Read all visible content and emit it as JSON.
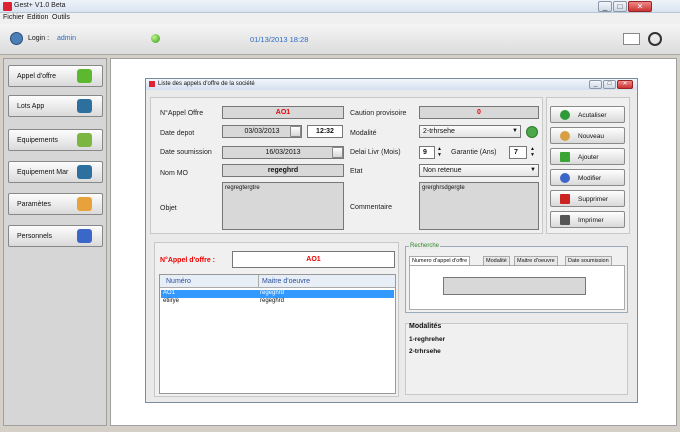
{
  "window": {
    "title": "Gest+ V1.0 Beta"
  },
  "menu": [
    "Fichier",
    "Edition",
    "Outils"
  ],
  "toolbar": {
    "login_label": "Login :",
    "user": "admin",
    "datetime": "01/13/2013  18:28"
  },
  "sidebar": {
    "items": [
      {
        "label": "Appel d'offre",
        "icon": "offer-icon",
        "color": "#5cb82e"
      },
      {
        "label": "Lots App",
        "icon": "camera-icon",
        "color": "#2d6f9e"
      },
      {
        "label": "Equipements",
        "icon": "box-icon",
        "color": "#7bb640"
      },
      {
        "label": "Equipement Mar",
        "icon": "camera-icon",
        "color": "#2d6f9e"
      },
      {
        "label": "Paramètes",
        "icon": "settings-icon",
        "color": "#e7a23b"
      },
      {
        "label": "Personnels",
        "icon": "people-icon",
        "color": "#3b67c9"
      }
    ]
  },
  "inner": {
    "title": "Liste des appels d'offre de la société",
    "form": {
      "napp_label": "N°Appel Offre",
      "napp_value": "AO1",
      "date_depot_label": "Date depot",
      "date_depot_value": "03/03/2013",
      "time_value": "12:32",
      "date_soum_label": "Date soumission",
      "date_soum_value": "16/03/2013",
      "nom_mo_label": "Nom MO",
      "nom_mo_value": "regeghrd",
      "objet_label": "Objet",
      "objet_value": "regregtergtre",
      "caution_label": "Caution provisoire",
      "caution_value": "0",
      "modalite_label": "Modalité",
      "modalite_value": "2-trhrsehe",
      "delai_label": "Delai Livr (Mois)",
      "delai_value": "9",
      "garantie_label": "Garantie (Ans)",
      "garantie_value": "7",
      "etat_label": "Etat",
      "etat_value": "Non retenue",
      "commentaire_label": "Commentaire",
      "commentaire_value": "grerghrsdgergte"
    },
    "actions": [
      {
        "label": "Acutaliser",
        "color": "#2e9a3a"
      },
      {
        "label": "Nouveau",
        "color": "#d8a040"
      },
      {
        "label": "Ajouter",
        "color": "#3aa535"
      },
      {
        "label": "Modifier",
        "color": "#3a66c8"
      },
      {
        "label": "Supprimer",
        "color": "#cc2222"
      },
      {
        "label": "Imprimer",
        "color": "#555555"
      }
    ],
    "list": {
      "search_label": "N°Appel d'offre :",
      "search_value": "AO1",
      "columns": [
        "Numéro",
        "Maitre d'oeuvre"
      ],
      "rows": [
        {
          "numero": "AO1",
          "maitre": "regeghrd",
          "selected": true
        },
        {
          "numero": "etiirye",
          "maitre": "regeghrd",
          "selected": false
        }
      ]
    },
    "recherche": {
      "title": "Recherche",
      "tabs": [
        "Numero d'appel d'offre",
        "Modalité",
        "Maitre d'oeuvre",
        "Date soumission"
      ]
    },
    "modalites": {
      "title": "Modalités",
      "items": [
        "1-reghreher",
        "2-trhrsehe"
      ]
    }
  }
}
